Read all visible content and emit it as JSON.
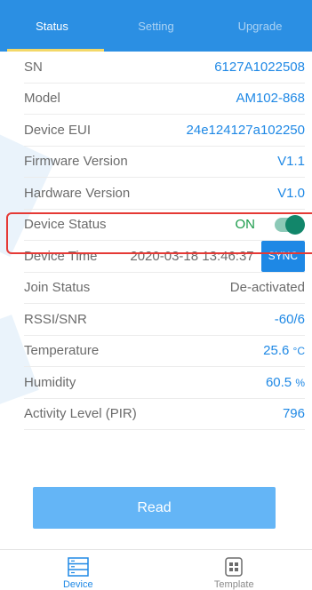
{
  "tabs": [
    {
      "label": "Status",
      "active": true
    },
    {
      "label": "Setting",
      "active": false
    },
    {
      "label": "Upgrade",
      "active": false
    }
  ],
  "rows": {
    "sn": {
      "label": "SN",
      "value": "6127A1022508"
    },
    "model": {
      "label": "Model",
      "value": "AM102-868"
    },
    "device_eui": {
      "label": "Device EUI",
      "value": "24e124127a102250"
    },
    "firmware": {
      "label": "Firmware Version",
      "value": "V1.1"
    },
    "hardware": {
      "label": "Hardware Version",
      "value": "V1.0"
    },
    "device_status": {
      "label": "Device Status",
      "state_text": "ON",
      "enabled": true
    },
    "device_time": {
      "label": "Device Time",
      "value": "2020-03-18 13:46:37",
      "sync_label": "SYNC"
    },
    "join_status": {
      "label": "Join Status",
      "value": "De-activated"
    },
    "rssi": {
      "label": "RSSI/SNR",
      "value": "-60/6"
    },
    "temperature": {
      "label": "Temperature",
      "value": "25.6",
      "unit": "°C"
    },
    "humidity": {
      "label": "Humidity",
      "value": "60.5",
      "unit": "%"
    },
    "activity": {
      "label": "Activity Level (PIR)",
      "value": "796"
    }
  },
  "read_button": "Read",
  "bottom_nav": [
    {
      "label": "Device",
      "icon": "device-icon",
      "active": true
    },
    {
      "label": "Template",
      "icon": "template-icon",
      "active": false
    }
  ],
  "colors": {
    "primary": "#2b8fe3",
    "tab_indicator": "#f3d868",
    "value_blue": "#1e88e5",
    "on_green": "#1b9b4a",
    "toggle_knob": "#12866a",
    "highlight_border": "#e53935",
    "read_button": "#64b5f6"
  }
}
